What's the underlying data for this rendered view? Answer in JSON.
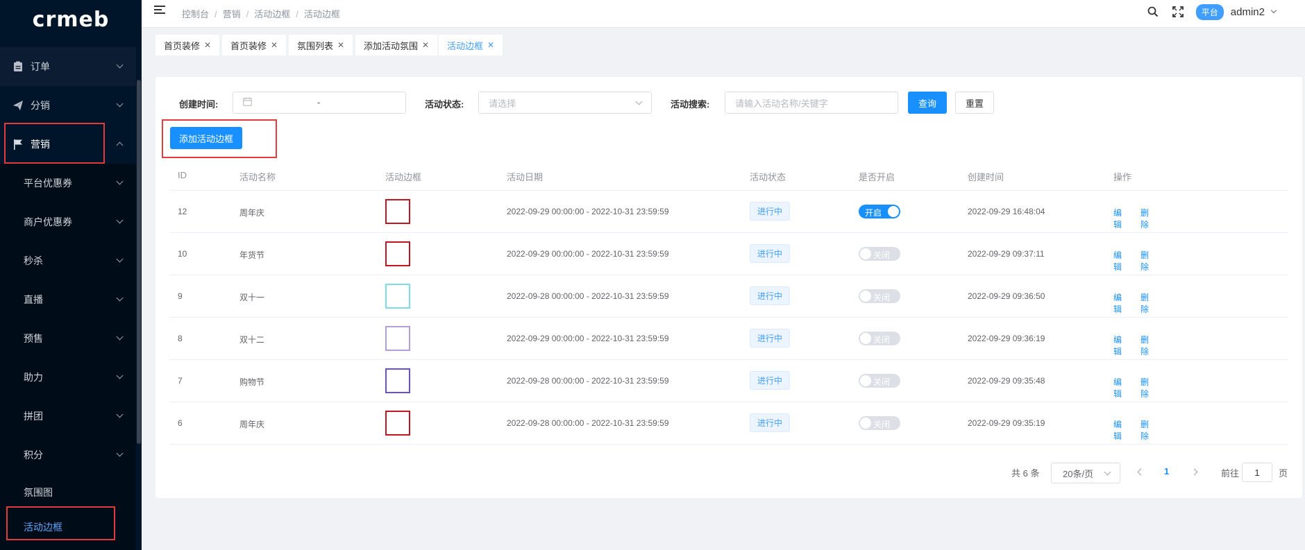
{
  "app": {
    "logo": "crmeb"
  },
  "sidebar": {
    "top_items": [
      {
        "label": "订单",
        "icon": "clipboard-icon"
      },
      {
        "label": "分销",
        "icon": "paper-plane-icon"
      },
      {
        "label": "营销",
        "icon": "flag-icon"
      }
    ],
    "sub_items": [
      {
        "label": "平台优惠券"
      },
      {
        "label": "商户优惠券"
      },
      {
        "label": "秒杀"
      },
      {
        "label": "直播"
      },
      {
        "label": "预售"
      },
      {
        "label": "助力"
      },
      {
        "label": "拼团"
      },
      {
        "label": "积分"
      },
      {
        "label": "氛围图"
      },
      {
        "label": "活动边框"
      }
    ]
  },
  "header": {
    "breadcrumb": [
      "控制台",
      "营销",
      "活动边框",
      "活动边框"
    ],
    "platform_badge": "平台",
    "username": "admin2"
  },
  "tags": [
    {
      "label": "首页装修"
    },
    {
      "label": "首页装修"
    },
    {
      "label": "氛围列表"
    },
    {
      "label": "添加活动氛围"
    },
    {
      "label": "活动边框"
    }
  ],
  "filters": {
    "create_time_label": "创建时间:",
    "date_separator": "-",
    "status_label": "活动状态:",
    "status_placeholder": "请选择",
    "search_label": "活动搜索:",
    "search_placeholder": "请输入活动名称/关键字",
    "query_button": "查询",
    "reset_button": "重置"
  },
  "add_button": "添加活动边框",
  "table": {
    "headers": [
      "ID",
      "活动名称",
      "活动边框",
      "活动日期",
      "活动状态",
      "是否开启",
      "创建时间",
      "操作"
    ],
    "rows": [
      {
        "id": "12",
        "name": "周年庆",
        "frame_color": "#c0161f",
        "date": "2022-09-29 00:00:00 - 2022-10-31 23:59:59",
        "status": "进行中",
        "enabled": true,
        "switch_label": "开启",
        "created": "2022-09-29 16:48:04",
        "edit": "编辑",
        "delete": "删除"
      },
      {
        "id": "10",
        "name": "年货节",
        "frame_color": "#c0161f",
        "date": "2022-09-29 00:00:00 - 2022-10-31 23:59:59",
        "status": "进行中",
        "enabled": false,
        "switch_label": "关闭",
        "created": "2022-09-29 09:37:11",
        "edit": "编辑",
        "delete": "删除"
      },
      {
        "id": "9",
        "name": "双十一",
        "frame_color": "#7ddbe8",
        "date": "2022-09-28 00:00:00 - 2022-10-31 23:59:59",
        "status": "进行中",
        "enabled": false,
        "switch_label": "关闭",
        "created": "2022-09-29 09:36:50",
        "edit": "编辑",
        "delete": "删除"
      },
      {
        "id": "8",
        "name": "双十二",
        "frame_color": "#b39ddb",
        "date": "2022-09-29 00:00:00 - 2022-10-31 23:59:59",
        "status": "进行中",
        "enabled": false,
        "switch_label": "关闭",
        "created": "2022-09-29 09:36:19",
        "edit": "编辑",
        "delete": "删除"
      },
      {
        "id": "7",
        "name": "购物节",
        "frame_color": "#6a4fd6",
        "date": "2022-09-28 00:00:00 - 2022-10-31 23:59:59",
        "status": "进行中",
        "enabled": false,
        "switch_label": "关闭",
        "created": "2022-09-29 09:35:48",
        "edit": "编辑",
        "delete": "删除"
      },
      {
        "id": "6",
        "name": "周年庆",
        "frame_color": "#c0161f",
        "date": "2022-09-28 00:00:00 - 2022-10-31 23:59:59",
        "status": "进行中",
        "enabled": false,
        "switch_label": "关闭",
        "created": "2022-09-29 09:35:19",
        "edit": "编辑",
        "delete": "删除"
      }
    ]
  },
  "pagination": {
    "total": "共 6 条",
    "page_size": "20条/页",
    "current_page": "1",
    "goto_label": "前往",
    "goto_value": "1",
    "page_unit": "页"
  }
}
